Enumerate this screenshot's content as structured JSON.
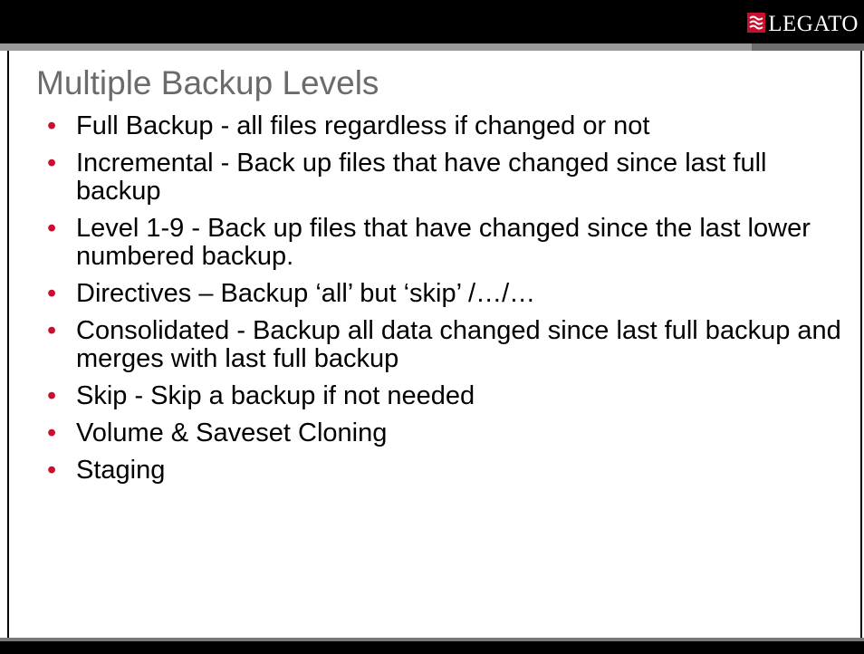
{
  "header": {
    "brand": "LEGATO",
    "brand_color": "#c8102e"
  },
  "slide": {
    "title": "Multiple Backup Levels",
    "bullets": [
      "Full Backup - all files regardless if changed or not",
      "Incremental - Back up files that have changed since last full backup",
      "Level 1-9 - Back up files that have changed since the last lower numbered backup.",
      "Directives – Backup ‘all’ but ‘skip’ /…/…",
      "Consolidated - Backup all data changed since last full backup and merges with last full backup",
      "Skip - Skip a backup if not needed",
      "Volume & Saveset Cloning",
      "Staging"
    ]
  }
}
